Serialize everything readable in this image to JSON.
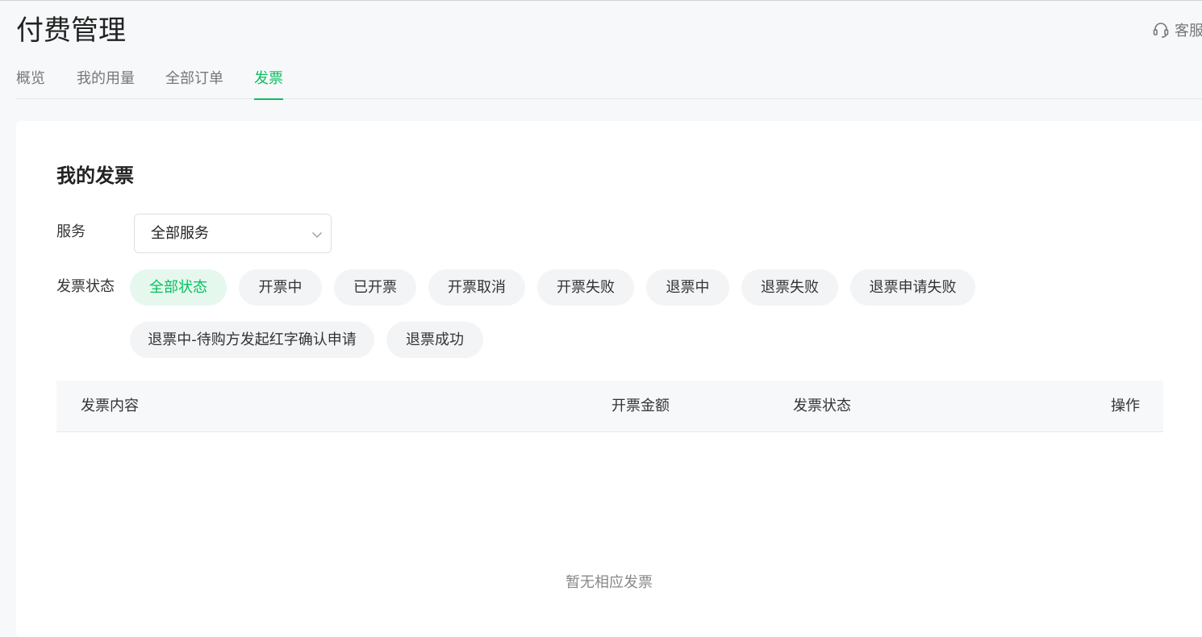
{
  "header": {
    "title": "付费管理",
    "support_label": "客服",
    "support_icon": "headset-icon"
  },
  "tabs": [
    {
      "label": "概览",
      "active": false
    },
    {
      "label": "我的用量",
      "active": false
    },
    {
      "label": "全部订单",
      "active": false
    },
    {
      "label": "发票",
      "active": true
    }
  ],
  "invoices": {
    "title": "我的发票",
    "service_label": "服务",
    "service_value": "全部服务",
    "status_label": "发票状态",
    "status_chips": [
      {
        "label": "全部状态",
        "active": true
      },
      {
        "label": "开票中",
        "active": false
      },
      {
        "label": "已开票",
        "active": false
      },
      {
        "label": "开票取消",
        "active": false
      },
      {
        "label": "开票失败",
        "active": false
      },
      {
        "label": "退票中",
        "active": false
      },
      {
        "label": "退票失败",
        "active": false
      },
      {
        "label": "退票申请失败",
        "active": false
      },
      {
        "label": "退票中-待购方发起红字确认申请",
        "active": false
      },
      {
        "label": "退票成功",
        "active": false
      }
    ],
    "columns": [
      "发票内容",
      "开票金额",
      "发票状态",
      "操作"
    ],
    "empty_text": "暂无相应发票"
  },
  "colors": {
    "accent": "#07c160",
    "chip_active_bg": "#e6f8ee",
    "chip_bg": "#f3f4f6",
    "page_bg": "#f7f8fa"
  }
}
